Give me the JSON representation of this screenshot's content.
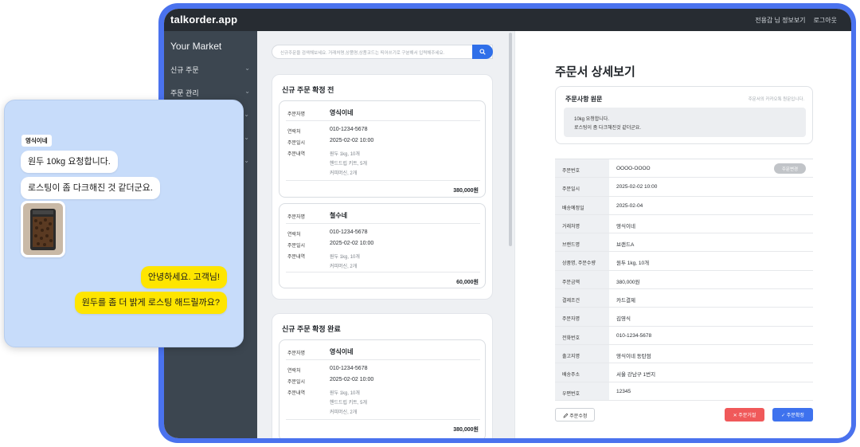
{
  "app": {
    "brand": "talkorder.app",
    "top_links": [
      "전용갑 님 정보보기",
      "로그아웃"
    ]
  },
  "sidebar": {
    "title": "Your Market",
    "items": [
      {
        "label": "신규 주문"
      },
      {
        "label": "주문 관리"
      }
    ]
  },
  "search": {
    "placeholder": "신규주문을 검색해보세요. 거래처명,상품명,상품코드는 띄어쓰기로 구분해서 입력해주세요."
  },
  "panels": [
    {
      "title": "신규 주문 확정 전",
      "cards": [
        {
          "orderer_label": "주문자명",
          "orderer": "영식이네",
          "contact_label": "연락처",
          "contact": "010-1234-5678",
          "date_label": "주문일시",
          "date": "2025-02-02  10:00",
          "items_label": "주문내역",
          "items": [
            "원두 1kg, 10개",
            "핸드드립 키트, 5개",
            "커피머신, 2개"
          ],
          "total": "380,000원"
        },
        {
          "orderer_label": "주문자명",
          "orderer": "철수네",
          "contact_label": "연락처",
          "contact": "010-1234-5678",
          "date_label": "주문일시",
          "date": "2025-02-02  10:00",
          "items_label": "주문내역",
          "items": [
            "원두 1kg, 10개",
            "커피머신, 2개"
          ],
          "total": "60,000원"
        }
      ]
    },
    {
      "title": "신규 주문 확정 완료",
      "cards": [
        {
          "orderer_label": "주문자명",
          "orderer": "영식이네",
          "contact_label": "연락처",
          "contact": "010-1234-5678",
          "date_label": "주문일시",
          "date": "2025-02-02  10:00",
          "items_label": "주문내역",
          "items": [
            "원두 1kg, 10개",
            "핸드드립 키트, 5개",
            "커피머신, 2개"
          ],
          "total": "380,000원"
        }
      ]
    }
  ],
  "detail": {
    "title": "주문서 상세보기",
    "original": {
      "title": "주문사항 원문",
      "note": "주문서의 카카오톡 원문입니다.",
      "lines": [
        "10kg 요청합니다.",
        "로스팅이 좀 다크해진것 같더군요."
      ]
    },
    "rows": [
      {
        "key": "주문번호",
        "value": "OOOO-OOOO"
      },
      {
        "key": "주문일시",
        "value": "2025-02-02 10:00"
      },
      {
        "key": "배송예정일",
        "value": "2025-02-04"
      },
      {
        "key": "거래처명",
        "value": "영식이네"
      },
      {
        "key": "브랜드명",
        "value": "브랜드A"
      },
      {
        "key": "상품명, 주문수량",
        "value": "원두 1kg, 10개"
      },
      {
        "key": "주문금액",
        "value": "380,000원"
      },
      {
        "key": "결제조건",
        "value": "카드결제"
      },
      {
        "key": "주문자명",
        "value": "김영식"
      },
      {
        "key": "전화번호",
        "value": "010-1234-5678"
      },
      {
        "key": "출고지명",
        "value": "영식이네 동탄점"
      },
      {
        "key": "배송주소",
        "value": "서울 강남구 1번지"
      },
      {
        "key": "우편번호",
        "value": "12345"
      }
    ],
    "status_badge": "주문변경",
    "buttons": {
      "edit": "주문수정",
      "reject": "주문거절",
      "confirm": "주문확정"
    }
  },
  "chat": {
    "sender": "영식이네",
    "incoming": [
      "원두 10kg 요청합니다.",
      "로스팅이 좀 다크해진 것 같더군요."
    ],
    "outgoing": [
      "안녕하세요. 고객님!",
      "원두를 좀 더 밝게 로스팅 해드릴까요?"
    ]
  },
  "colors": {
    "frame": "#4a72ee",
    "topbar": "#272c32",
    "sidebar": "#3c4650",
    "primary": "#2f6fe9",
    "reject": "#f0595a",
    "chat_bg": "#c7dcfa",
    "chat_outgoing": "#fee500"
  }
}
